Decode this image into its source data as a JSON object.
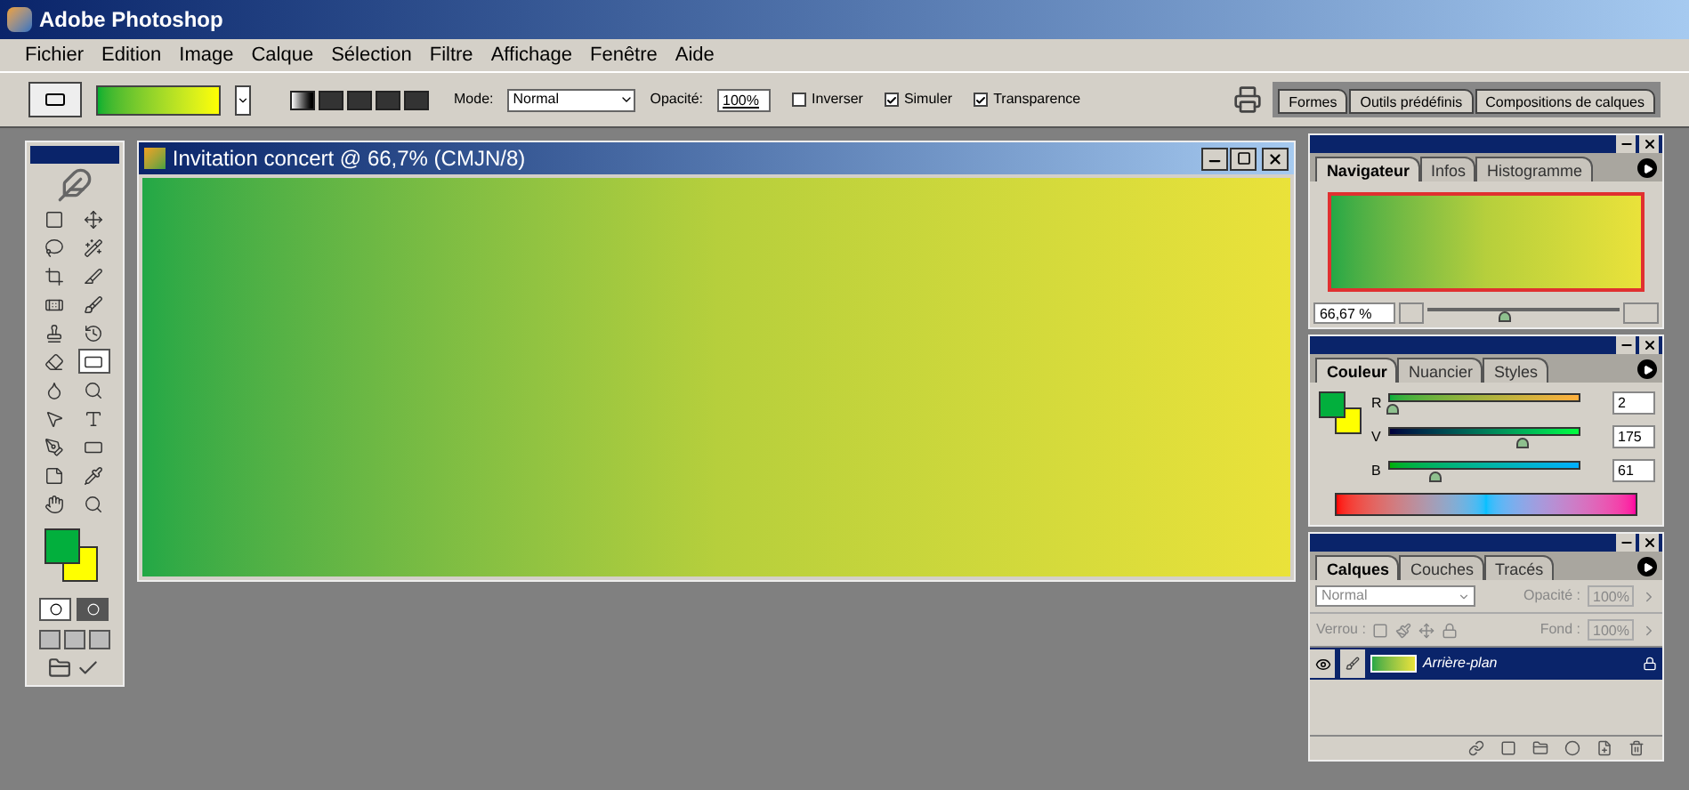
{
  "app_title": "Adobe Photoshop",
  "menu": [
    "Fichier",
    "Edition",
    "Image",
    "Calque",
    "Sélection",
    "Filtre",
    "Affichage",
    "Fenêtre",
    "Aide"
  ],
  "options_bar": {
    "mode_label": "Mode:",
    "mode_value": "Normal",
    "opacity_label": "Opacité:",
    "opacity_value": "100%",
    "checkboxes": [
      {
        "label": "Inverser",
        "checked": false
      },
      {
        "label": "Simuler",
        "checked": true
      },
      {
        "label": "Transparence",
        "checked": true
      }
    ],
    "palette_tabs": [
      "Formes",
      "Outils prédéfinis",
      "Compositions de calques"
    ]
  },
  "toolbox": {
    "tools": [
      {
        "selected": false
      },
      {
        "selected": false
      },
      {
        "selected": false
      },
      {
        "selected": false
      },
      {
        "selected": false
      },
      {
        "selected": false
      },
      {
        "selected": false
      },
      {
        "selected": false
      },
      {
        "selected": false
      },
      {
        "selected": false
      },
      {
        "selected": false
      },
      {
        "selected": true
      },
      {
        "selected": false
      },
      {
        "selected": false
      },
      {
        "selected": false
      },
      {
        "selected": false
      },
      {
        "selected": false
      },
      {
        "selected": false
      },
      {
        "selected": false
      },
      {
        "selected": false
      },
      {
        "selected": false
      },
      {
        "selected": false
      }
    ]
  },
  "document": {
    "title": "Invitation concert @ 66,7% (CMJN/8)"
  },
  "navigator": {
    "tabs": [
      {
        "label": "Navigateur",
        "selected": true
      },
      {
        "label": "Infos",
        "selected": false
      },
      {
        "label": "Histogramme",
        "selected": false
      }
    ],
    "zoom": "66,67 %",
    "level": 0.4
  },
  "color": {
    "tabs": [
      {
        "label": "Couleur",
        "selected": true
      },
      {
        "label": "Nuancier",
        "selected": false
      },
      {
        "label": "Styles",
        "selected": false
      }
    ],
    "channels": [
      {
        "label": "R",
        "value": "2",
        "level": 0.01
      },
      {
        "label": "V",
        "value": "175",
        "level": 0.69
      },
      {
        "label": "B",
        "value": "61",
        "level": 0.24
      }
    ]
  },
  "layers": {
    "tabs": [
      {
        "label": "Calques",
        "selected": true
      },
      {
        "label": "Couches",
        "selected": false
      },
      {
        "label": "Tracés",
        "selected": false
      }
    ],
    "blend_mode": "Normal",
    "opacity_label": "Opacité :",
    "opacity_value": "100%",
    "lock_label": "Verrou :",
    "fill_label": "Fond :",
    "fill_value": "100%",
    "items": [
      {
        "name": "Arrière-plan",
        "selected": true,
        "visible": true,
        "locked": true
      }
    ]
  }
}
